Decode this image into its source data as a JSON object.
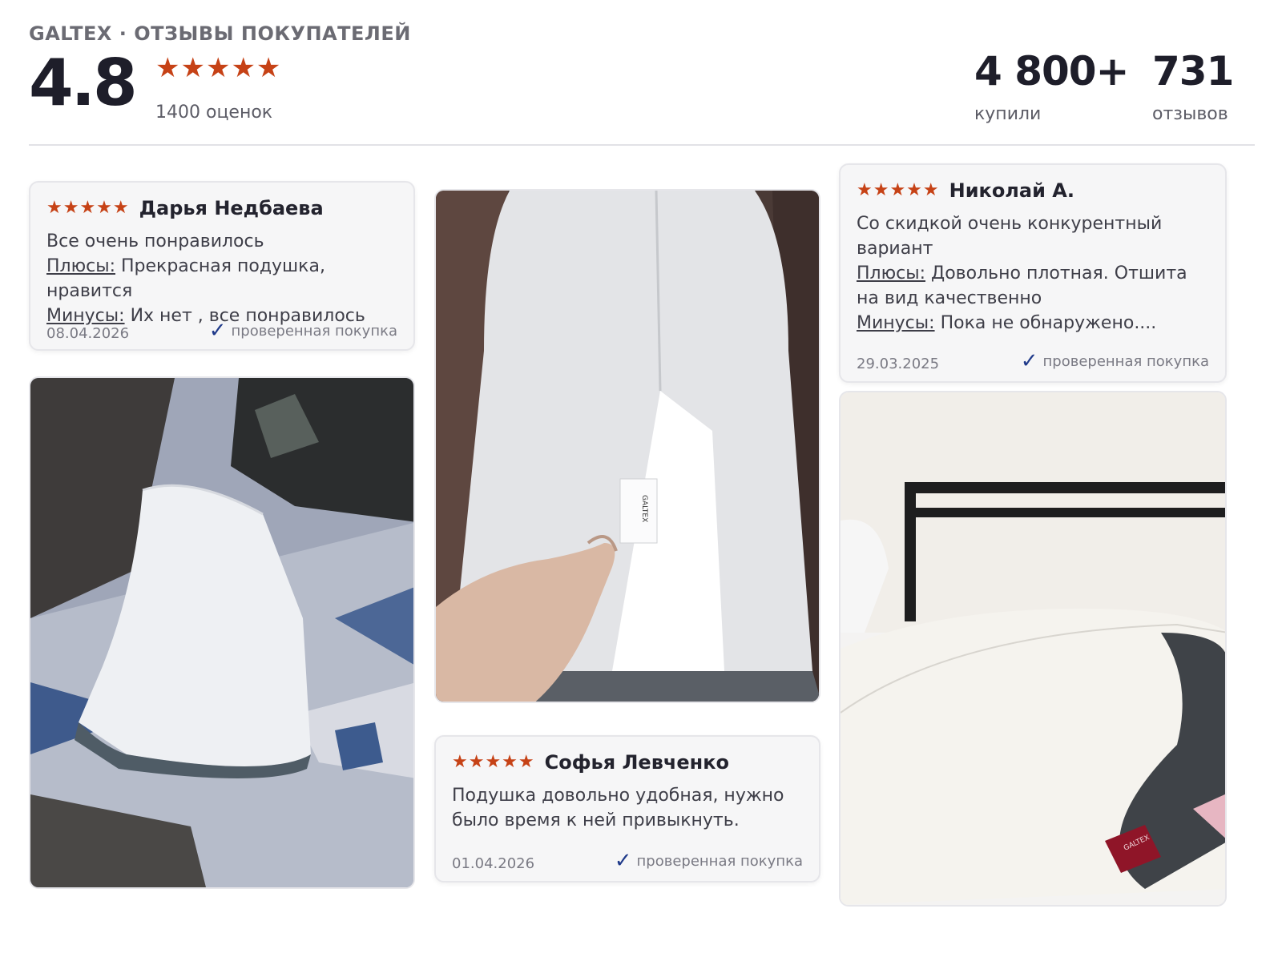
{
  "header": {
    "brand": "GALTEX · ОТЗЫВЫ ПОКУПАТЕЛЕЙ",
    "rating": "4.8",
    "stars": "★★★★★",
    "ratings_count": "1400 оценок",
    "bought_value": "4 800+",
    "bought_label": "купили",
    "reviews_value": "731",
    "reviews_label": "отзывов"
  },
  "colors": {
    "star": "#c64216",
    "check": "#1f3a8a",
    "card_bg": "#f6f6f7"
  },
  "reviews": [
    {
      "stars": "★★★★★",
      "author": "Дарья Недбаева",
      "text": "Все очень понравилось",
      "pros_label": "Плюсы:",
      "pros": "Прекрасная подушка, нравится",
      "cons_label": "Минусы:",
      "cons": "Их нет , все понравилось",
      "date": "08.04.2026",
      "verified": "проверенная покупка"
    },
    {
      "stars": "★★★★★",
      "author": "Софья Левченко",
      "text": "Подушка довольно удобная, нужно было время к ней привыкнуть.",
      "date": "01.04.2026",
      "verified": "проверенная покупка"
    },
    {
      "stars": "★★★★★",
      "author": "Николай А.",
      "text": "Со скидкой очень конкурентный вариант",
      "pros_label": "Плюсы:",
      "pros": "Довольно плотная. Отшита на вид качественно",
      "cons_label": "Минусы:",
      "cons": "Пока не обнаружено....",
      "date": "29.03.2025",
      "verified": "проверенная покупка"
    }
  ],
  "photos": {
    "tag_label": "GALTEX",
    "label_text": "GALTEX"
  }
}
